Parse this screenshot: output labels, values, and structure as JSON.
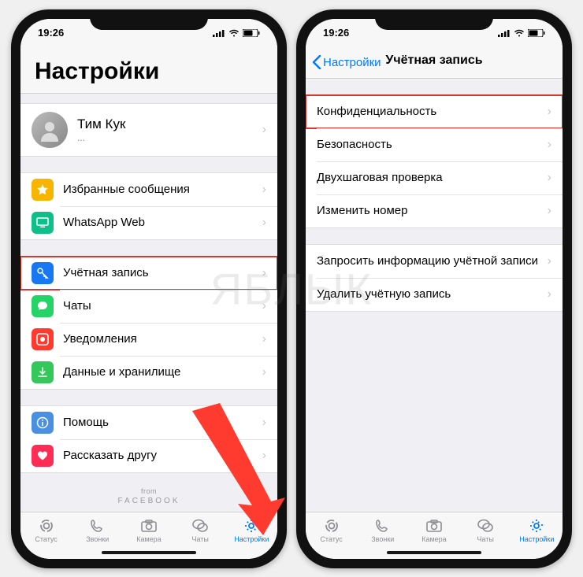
{
  "watermark": "ЯБЛЫК",
  "status": {
    "time": "19:26"
  },
  "left": {
    "title": "Настройки",
    "profile": {
      "name": "Тим Кук",
      "sub": "..."
    },
    "group2": [
      {
        "icon": "star",
        "color": "#f7b500",
        "label": "Избранные сообщения"
      },
      {
        "icon": "desktop",
        "color": "#0fbf8a",
        "label": "WhatsApp Web"
      }
    ],
    "group3": [
      {
        "icon": "key",
        "color": "#1877f2",
        "label": "Учётная запись",
        "hl": true
      },
      {
        "icon": "chat",
        "color": "#25d366",
        "label": "Чаты"
      },
      {
        "icon": "bell",
        "color": "#ff3b30",
        "label": "Уведомления"
      },
      {
        "icon": "data",
        "color": "#34c759",
        "label": "Данные и хранилище"
      }
    ],
    "group4": [
      {
        "icon": "info",
        "color": "#4a90e2",
        "label": "Помощь"
      },
      {
        "icon": "heart",
        "color": "#ff2d55",
        "label": "Рассказать другу"
      }
    ],
    "footer": {
      "from": "from",
      "brand": "FACEBOOK"
    }
  },
  "right": {
    "back": "Настройки",
    "title": "Учётная запись",
    "group1": [
      {
        "label": "Конфиденциальность",
        "hl": true
      },
      {
        "label": "Безопасность"
      },
      {
        "label": "Двухшаговая проверка"
      },
      {
        "label": "Изменить номер"
      }
    ],
    "group2": [
      {
        "label": "Запросить информацию учётной записи"
      },
      {
        "label": "Удалить учётную запись"
      }
    ]
  },
  "tabs": [
    {
      "key": "status",
      "label": "Статус"
    },
    {
      "key": "calls",
      "label": "Звонки"
    },
    {
      "key": "camera",
      "label": "Камера"
    },
    {
      "key": "chats",
      "label": "Чаты"
    },
    {
      "key": "settings",
      "label": "Настройки",
      "active": true
    }
  ]
}
